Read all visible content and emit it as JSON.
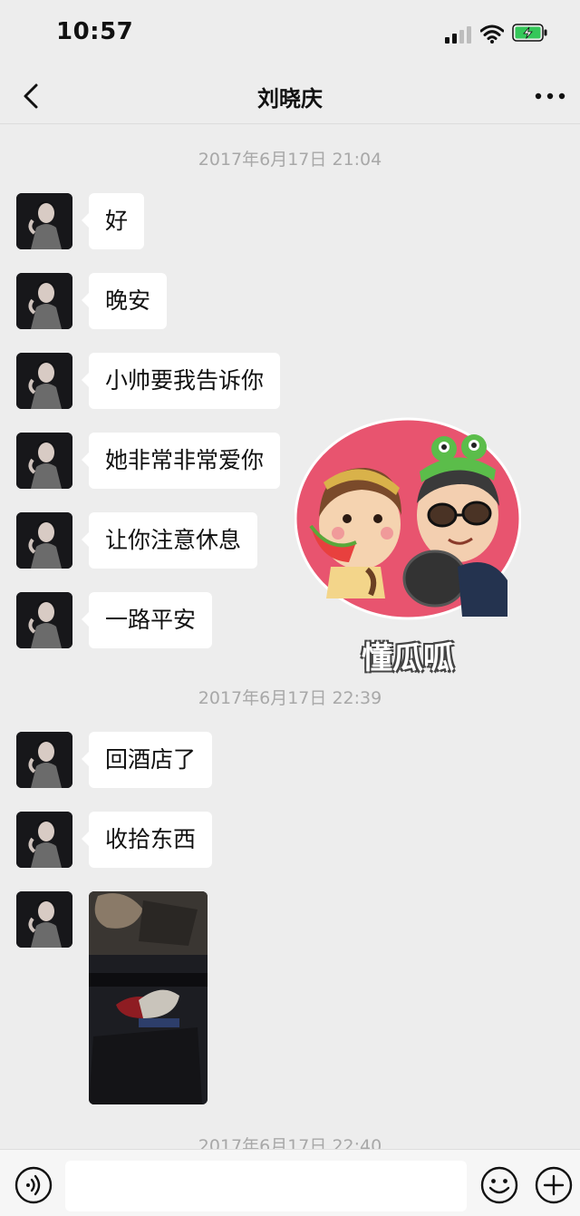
{
  "status_bar": {
    "time": "10:57",
    "signal_icon": "cellular-signal-icon",
    "wifi_icon": "wifi-icon",
    "battery_icon": "battery-charging-icon",
    "battery_color": "#34c759"
  },
  "nav": {
    "back_icon": "chevron-left-icon",
    "title": "刘晓庆",
    "more_icon": "more-dots-icon"
  },
  "chat": {
    "timestamps": [
      "2017年6月17日 21:04",
      "2017年6月17日 22:39",
      "2017年6月17日 22:40"
    ],
    "messages": [
      {
        "text": "好"
      },
      {
        "text": "晚安"
      },
      {
        "text": "小帅要我告诉你"
      },
      {
        "text": "她非常非常爱你"
      },
      {
        "text": "让你注意休息"
      },
      {
        "text": "一路平安"
      },
      {
        "text": "回酒店了"
      },
      {
        "text": "收拾东西"
      }
    ],
    "photo_message": "image-message"
  },
  "watermark": {
    "text": "懂瓜呱",
    "colors": {
      "circle": "#e8546f"
    }
  },
  "input_bar": {
    "voice_icon": "voice-input-icon",
    "input_value": "",
    "emoji_icon": "emoji-icon",
    "plus_icon": "plus-icon"
  },
  "colors": {
    "background": "#ededed",
    "bubble": "#ffffff",
    "timestamp_text": "#a8a8a8"
  }
}
